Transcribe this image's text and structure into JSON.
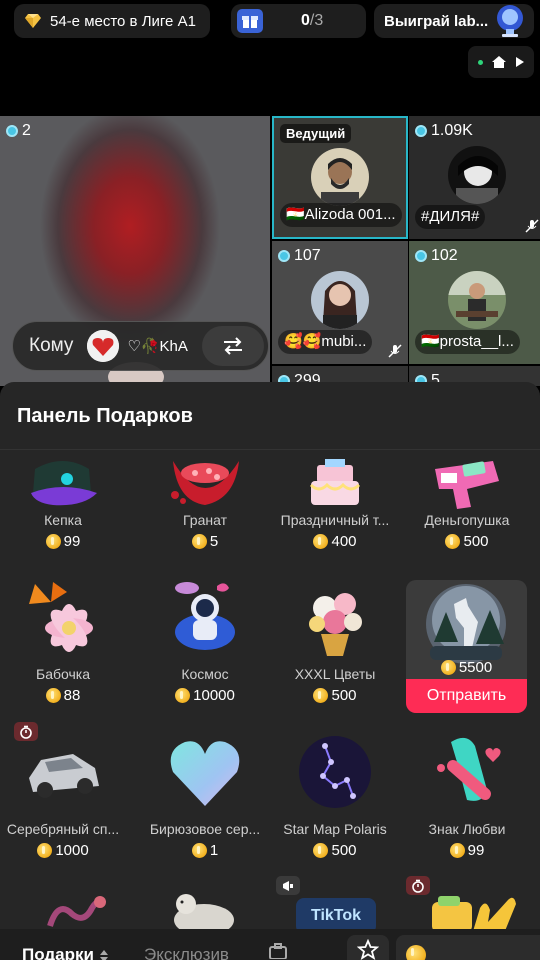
{
  "top_bar": {
    "league_label": "54-е место в Лиге A1",
    "progress_done": "0",
    "progress_total": "/3",
    "win_label": "Выиграй lab..."
  },
  "grid": {
    "main_viewers": "2",
    "tiles": [
      {
        "badge": "Ведущий",
        "name": "🇹🇯Alizoda 001..."
      },
      {
        "viewers": "1.09K",
        "name": "#ДИЛЯ#"
      },
      {
        "viewers": "107",
        "name": "🥰🥰mubi..."
      },
      {
        "viewers": "102",
        "name": "🇹🇯prosta__l..."
      },
      {
        "viewers": "299"
      },
      {
        "viewers": "5"
      }
    ]
  },
  "recipient": {
    "label": "Кому",
    "name": "♡🥀KhA"
  },
  "panel": {
    "title": "Панель Подарков",
    "gifts": [
      {
        "name": "Кепка",
        "price": "99"
      },
      {
        "name": "Гранат",
        "price": "5"
      },
      {
        "name": "Праздничный т...",
        "price": "400"
      },
      {
        "name": "Деньгопушка",
        "price": "500"
      },
      {
        "name": "Бабочка",
        "price": "88"
      },
      {
        "name": "Космос",
        "price": "10000"
      },
      {
        "name": "XXXL Цветы",
        "price": "500"
      },
      {
        "name": "Серебряный сп...",
        "price": "1000"
      },
      {
        "name": "Бирюзовое сер...",
        "price": "1"
      },
      {
        "name": "Star Map Polaris",
        "price": "500"
      },
      {
        "name": "Знак Любви",
        "price": "99"
      }
    ],
    "selected": {
      "price": "5500",
      "send_label": "Отправить"
    },
    "partial_art": [
      "TikTok"
    ]
  },
  "bottom": {
    "tab_gifts": "Подарки",
    "tab_exclusive": "Эксклюзив"
  },
  "colors": {
    "accent": "#fe2c55",
    "host_border": "#28b7c8",
    "panel_bg": "#262626"
  }
}
